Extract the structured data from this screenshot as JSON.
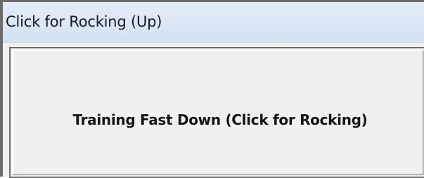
{
  "window": {
    "title": "Click for Rocking (Up)"
  },
  "main": {
    "button_label": "Training Fast Down (Click for Rocking)"
  },
  "colors": {
    "title_bar": "#dbe7f6",
    "client_background": "#f0f0f0",
    "window_border": "#6b6b6b"
  }
}
